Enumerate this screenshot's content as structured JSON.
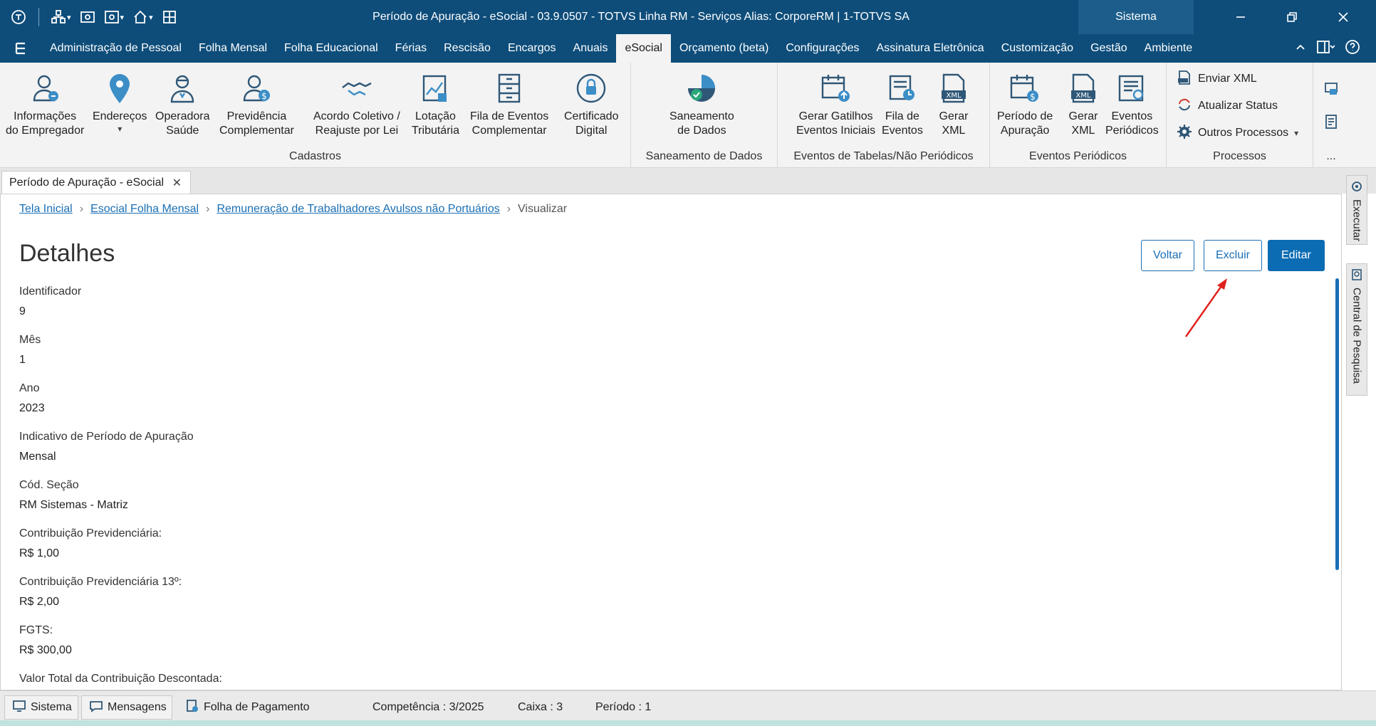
{
  "window": {
    "title": "Período de Apuração - eSocial - 03.9.0507 - TOTVS Linha RM - Serviços  Alias: CorporeRM | 1-TOTVS SA",
    "sistema_label": "Sistema"
  },
  "menu": {
    "items": [
      "Administração de Pessoal",
      "Folha Mensal",
      "Folha Educacional",
      "Férias",
      "Rescisão",
      "Encargos",
      "Anuais",
      "eSocial",
      "Orçamento (beta)",
      "Configurações",
      "Assinatura Eletrônica",
      "Customização",
      "Gestão",
      "Ambiente"
    ],
    "active": "eSocial"
  },
  "ribbon": {
    "groups": {
      "cadastros": "Cadastros",
      "saneamento": "Saneamento de Dados",
      "eventos_tabelas": "Eventos de Tabelas/Não Periódicos",
      "eventos_periodicos": "Eventos Periódicos",
      "processos": "Processos",
      "more": "..."
    },
    "buttons": {
      "informacoes_empregador": "Informações\ndo Empregador",
      "enderecos": "Endereços",
      "operadora_saude": "Operadora\nSaúde",
      "previdencia_complementar": "Previdência\nComplementar",
      "acordo_coletivo": "Acordo Coletivo /\nReajuste por Lei",
      "lotacao_tributaria": "Lotação\nTributária",
      "fila_eventos_complementar": "Fila de Eventos\nComplementar",
      "certificado_digital": "Certificado\nDigital",
      "saneamento_dados": "Saneamento\nde Dados",
      "gerar_gatilhos": "Gerar Gatilhos\nEventos Iniciais",
      "fila_eventos": "Fila de\nEventos",
      "gerar_xml_tabelas": "Gerar\nXML",
      "periodo_apuracao": "Período de\nApuração",
      "gerar_xml_periodicos": "Gerar\nXML",
      "eventos_periodicos": "Eventos\nPeriódicos",
      "enviar_xml": "Enviar XML",
      "atualizar_status": "Atualizar Status",
      "outros_processos": "Outros Processos"
    }
  },
  "doc_tab": {
    "label": "Período de Apuração - eSocial"
  },
  "breadcrumb": {
    "items": [
      "Tela Inicial",
      "Esocial Folha Mensal",
      "Remuneração de Trabalhadores Avulsos não Portuários"
    ],
    "current": "Visualizar"
  },
  "page": {
    "title": "Detalhes",
    "actions": {
      "voltar": "Voltar",
      "excluir": "Excluir",
      "editar": "Editar"
    }
  },
  "fields": [
    {
      "label": "Identificador",
      "value": "9"
    },
    {
      "label": "Mês",
      "value": "1"
    },
    {
      "label": "Ano",
      "value": "2023"
    },
    {
      "label": "Indicativo de Período de Apuração",
      "value": "Mensal"
    },
    {
      "label": "Cód. Seção",
      "value": "RM Sistemas - Matriz"
    },
    {
      "label": "Contribuição Previdenciária:",
      "value": "R$ 1,00"
    },
    {
      "label": "Contribuição Previdenciária 13º:",
      "value": "R$ 2,00"
    },
    {
      "label": "FGTS:",
      "value": "R$ 300,00"
    },
    {
      "label": "Valor Total da Contribuição Descontada:",
      "value": ""
    }
  ],
  "side_tabs": {
    "executar": "Executar",
    "central_pesquisa": "Central de Pesquisa"
  },
  "statusbar": {
    "sistema": "Sistema",
    "mensagens": "Mensagens",
    "folha_pagamento": "Folha de Pagamento",
    "competencia": "Competência : 3/2025",
    "caixa": "Caixa : 3",
    "periodo": "Período : 1"
  },
  "colors": {
    "titlebar": "#0e4d7a",
    "accent": "#1a6fb5",
    "primary_button": "#0c6cb3",
    "annotation_arrow": "#e0201b"
  },
  "annotation": {
    "arrow_target": "excluir-button"
  }
}
